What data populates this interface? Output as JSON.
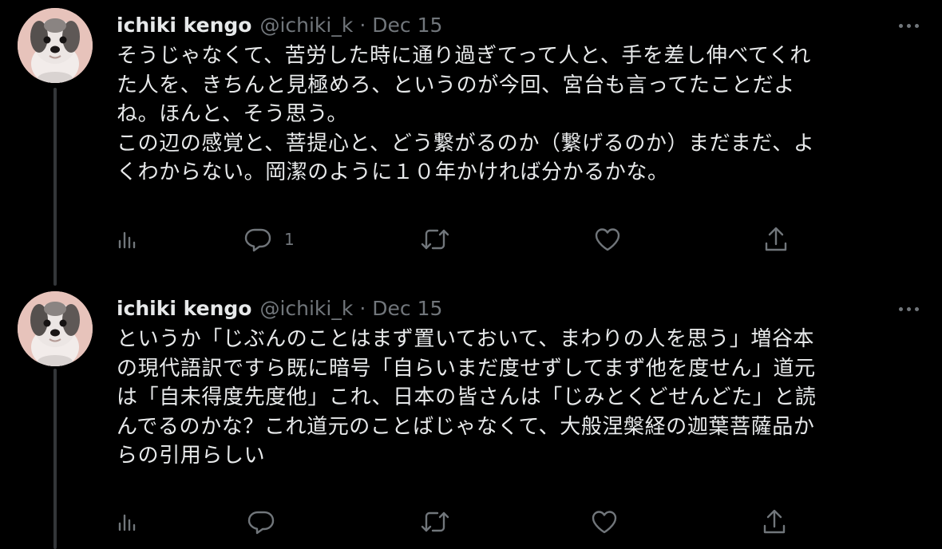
{
  "tweets": [
    {
      "name": "ichiki kengo",
      "handle": "@ichiki_k",
      "separator": "·",
      "date": "Dec 15",
      "lines": [
        "そうじゃなくて、苦労した時に通り過ぎてって人と、手を差し伸べてくれ",
        "た人を、きちんと見極めろ、というのが今回、宮台も言ってたことだよ",
        "ね。ほんと、そう思う。",
        "この辺の感覚と、菩提心と、どう繋がるのか（繋げるのか）まだまだ、よ",
        "くわからない。岡潔のように１０年かければ分かるかな。"
      ],
      "reply_count": "1"
    },
    {
      "name": "ichiki kengo",
      "handle": "@ichiki_k",
      "separator": "·",
      "date": "Dec 15",
      "lines": [
        "というか「じぶんのことはまず置いておいて、まわりの人を思う」増谷本",
        "の現代語訳ですら既に暗号「自らいまだ度せずしてまず他を度せん」道元",
        "は「自未得度先度他」これ、日本の皆さんは「じみとくどせんどた」と読",
        "んでるのかな？これ道元のことばじゃなくて、大般涅槃経の迦葉菩薩品か",
        "らの引用らしい"
      ],
      "reply_count": ""
    }
  ],
  "icons": {
    "views": "bar-chart-icon",
    "reply": "speech-bubble-icon",
    "retweet": "retweet-icon",
    "like": "heart-icon",
    "share": "share-upload-icon",
    "more": "ellipsis-icon"
  },
  "colors": {
    "background": "#000000",
    "text": "#e7e9ea",
    "secondary": "#71767b",
    "thread_line": "#333639"
  }
}
